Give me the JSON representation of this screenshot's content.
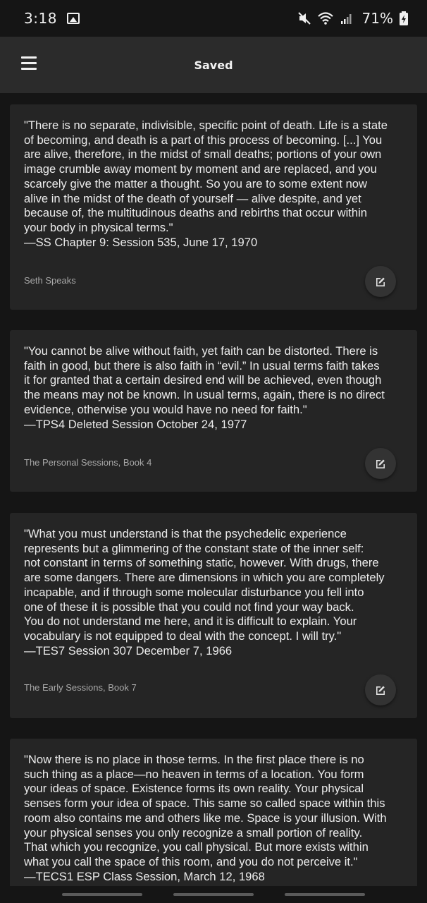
{
  "status_bar": {
    "time": "3:18",
    "battery_percent": "71%",
    "icons": [
      "image-icon",
      "mute-icon",
      "wifi-icon",
      "signal-icon",
      "battery-icon"
    ]
  },
  "app_bar": {
    "title": "Saved",
    "menu_icon": "hamburger-menu-icon"
  },
  "cards": [
    {
      "quote": "\"There is no separate, indivisible, specific point of death. Life is a state\nof becoming, and death is a part of this process of becoming. [...] You\nare alive, therefore, in the midst of small deaths; portions of your own\nimage crumble away moment by moment and are replaced, and you\nscarcely give the matter a thought. So you are to some extent now\nalive in the midst of the death of yourself — alive despite, and yet\nbecause of, the multitudinous deaths and rebirths that occur within\nyour body in physical terms.\"\n—SS Chapter 9: Session 535, June 17, 1970",
      "source": "Seth Speaks"
    },
    {
      "quote": "\"You cannot be alive without faith, yet faith can be distorted. There is\nfaith in good, but there is also faith in “evil.” In usual terms faith takes\nit for granted that a certain desired end will be achieved, even though\nthe means may not be known. In usual terms, again, there is no direct\nevidence, otherwise you would have no need for faith.\"\n—TPS4 Deleted Session October 24, 1977",
      "source": "The Personal Sessions, Book 4"
    },
    {
      "quote": "\"What you must understand is that the psychedelic experience\nrepresents but a glimmering of the constant state of the inner self:\nnot constant in terms of something static, however. With drugs, there\nare some dangers. There are dimensions in which you are completely\nincapable, and if through some molecular disturbance you fell into\none of these it is possible that you could not find your way back.\nYou do not understand me here, and it is difficult to explain. Your\nvocabulary is not equipped to deal with the concept. I will try.\"\n—TES7 Session 307 December 7, 1966",
      "source": "The Early Sessions, Book 7"
    },
    {
      "quote": "\"Now there is no place in those terms. In the first place there is no\nsuch thing as a place—no heaven in terms of a location. You form\nyour ideas of space. Existence forms its own reality. Your physical\nsenses form your idea of space. This same so called space within this\nroom also contains me and others like me. Space is your illusion. With\nyour physical senses you only recognize a small portion of reality.\nThat which you recognize, you call physical. But more exists within\nwhat you call the space of this room, and you do not perceive it.\"\n—TECS1 ESP Class Session, March 12, 1968",
      "source": ""
    }
  ],
  "colors": {
    "background": "#151515",
    "app_bar": "#2b2b2b",
    "card": "#252525",
    "text": "#ececec",
    "muted": "#a8a8a8"
  }
}
